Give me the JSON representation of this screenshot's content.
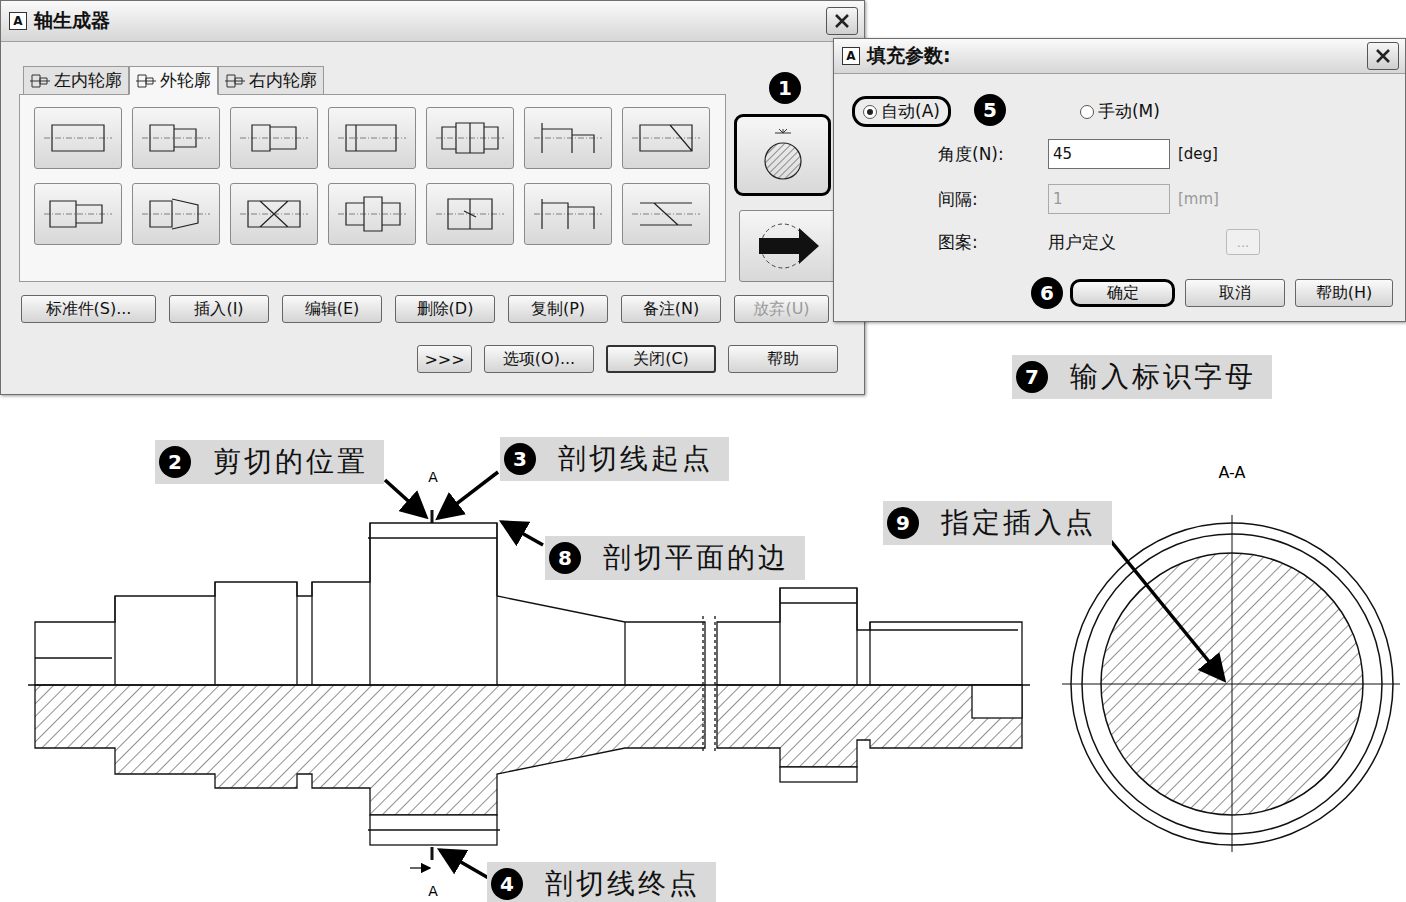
{
  "main_window": {
    "app_icon": "A",
    "title": "轴生成器",
    "tabs": [
      {
        "label": "左内轮廓",
        "selected": false
      },
      {
        "label": "外轮廓",
        "selected": true
      },
      {
        "label": "右内轮廓",
        "selected": false
      }
    ],
    "side_buttons": [
      {
        "highlighted": true
      },
      {
        "highlighted": false
      }
    ],
    "buttons": [
      {
        "label": "标准件(S)...",
        "disabled": false
      },
      {
        "label": "插入(I)",
        "disabled": false
      },
      {
        "label": "编辑(E)",
        "disabled": false
      },
      {
        "label": "删除(D)",
        "disabled": false
      },
      {
        "label": "复制(P)",
        "disabled": false
      },
      {
        "label": "备注(N)",
        "disabled": false
      },
      {
        "label": "放弃(U)",
        "disabled": true
      }
    ],
    "bottom_buttons": [
      {
        "label": ">>>",
        "default": false
      },
      {
        "label": "选项(O)...",
        "default": false
      },
      {
        "label": "关闭(C)",
        "default": true
      },
      {
        "label": "帮助",
        "default": false
      }
    ]
  },
  "fill_dialog": {
    "app_icon": "A",
    "title": "填充参数:",
    "radios": [
      {
        "label": "自动(A)",
        "selected": true,
        "highlighted": true
      },
      {
        "label": "手动(M)",
        "selected": false,
        "highlighted": false
      }
    ],
    "fields": [
      {
        "label": "角度(N):",
        "value": "45",
        "unit": "[deg]",
        "disabled": false
      },
      {
        "label": "间隔:",
        "value": "1",
        "unit": "[mm]",
        "disabled": true
      }
    ],
    "pattern": {
      "label": "图案:",
      "value": "用户定义",
      "button": "...",
      "button_disabled": true
    },
    "buttons": [
      {
        "label": "确定",
        "highlighted": true
      },
      {
        "label": "取消",
        "highlighted": false
      },
      {
        "label": "帮助(H)",
        "highlighted": false
      }
    ]
  },
  "callouts": [
    {
      "number": "1",
      "label": ""
    },
    {
      "number": "2",
      "label": "剪切的位置"
    },
    {
      "number": "3",
      "label": "剖切线起点"
    },
    {
      "number": "4",
      "label": "剖切线终点"
    },
    {
      "number": "5",
      "label": ""
    },
    {
      "number": "6",
      "label": ""
    },
    {
      "number": "7",
      "label": "输入标识字母"
    },
    {
      "number": "8",
      "label": "剖切平面的边"
    },
    {
      "number": "9",
      "label": "指定插入点"
    }
  ],
  "drawing": {
    "cut_letters": [
      "A",
      "A"
    ],
    "section_title": "A-A"
  }
}
